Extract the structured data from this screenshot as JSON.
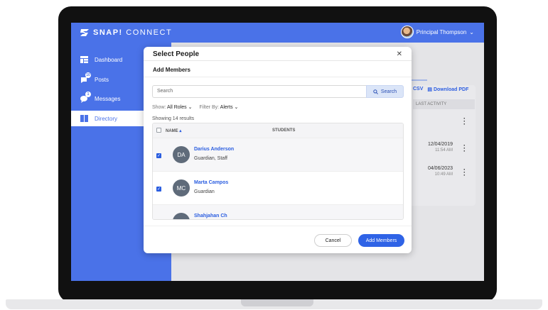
{
  "app": {
    "brand_bold": "SNAP!",
    "brand_rest": " CONNECT"
  },
  "user": {
    "name": "Principal Thompson"
  },
  "sidebar": {
    "items": [
      {
        "label": "Dashboard",
        "icon": "dashboard-icon"
      },
      {
        "label": "Posts",
        "icon": "posts-icon",
        "badge": "10"
      },
      {
        "label": "Messages",
        "icon": "messages-icon",
        "badge": "1"
      },
      {
        "label": "Directory",
        "icon": "directory-icon",
        "active": true
      }
    ]
  },
  "background": {
    "csv_label": "CSV",
    "pdf_label": "Download PDF",
    "last_activity_header": "LAST ACTIVITY",
    "rows": [
      {
        "date": "12/04/2019",
        "time": "11:54 AM"
      },
      {
        "date": "04/06/2023",
        "time": "10:49 AM"
      }
    ]
  },
  "modal": {
    "title": "Select People",
    "subtitle": "Add Members",
    "search": {
      "placeholder": "Search",
      "button_label": "Search"
    },
    "filters": {
      "show_label": "Show:",
      "show_value": "All Roles",
      "filter_label": "Filter By:",
      "filter_value": "Alerts"
    },
    "results_text": "Showing 14 results",
    "columns": {
      "name": "NAME",
      "students": "STUDENTS"
    },
    "people": [
      {
        "initials": "DA",
        "name": "Darius Anderson",
        "role": "Guardian, Staff",
        "checked": true
      },
      {
        "initials": "MC",
        "name": "Marta Campos",
        "role": "Guardian",
        "checked": true
      },
      {
        "initials": "SC",
        "name": "Shahjahan Ch",
        "role": "",
        "checked": false
      }
    ],
    "cancel_label": "Cancel",
    "add_label": "Add Members"
  },
  "colors": {
    "brand": "#4a72e8",
    "primary_button": "#2f63e6",
    "link": "#2a5de0"
  }
}
